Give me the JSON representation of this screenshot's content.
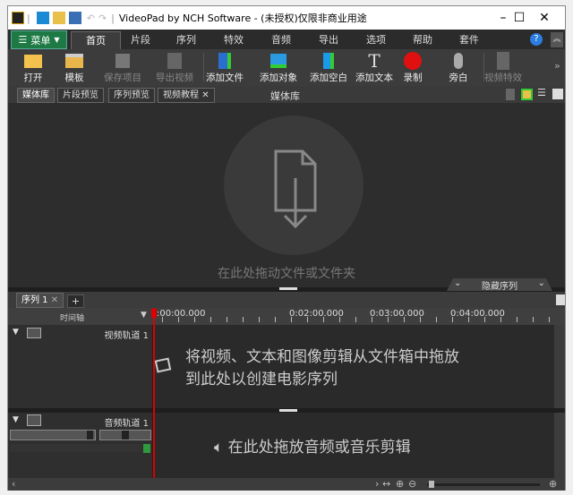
{
  "title": "VideoPad by NCH Software - (未授权)仅限非商业用途",
  "menu_label": "菜单",
  "tabs": [
    "首页",
    "片段",
    "序列",
    "特效",
    "音频",
    "导出",
    "选项",
    "帮助",
    "套件"
  ],
  "toolbar": [
    {
      "label": "打开",
      "icon": "folder-open-icon",
      "enabled": true
    },
    {
      "label": "模板",
      "icon": "template-folder-icon",
      "enabled": true
    },
    {
      "label": "保存项目",
      "icon": "save-icon",
      "enabled": false
    },
    {
      "label": "导出视频",
      "icon": "export-video-icon",
      "enabled": false
    },
    {
      "label": "添加文件",
      "icon": "add-file-icon",
      "enabled": true
    },
    {
      "label": "添加对象",
      "icon": "add-object-icon",
      "enabled": true
    },
    {
      "label": "添加空白",
      "icon": "add-blank-icon",
      "enabled": true
    },
    {
      "label": "添加文本",
      "icon": "add-text-icon",
      "enabled": true
    },
    {
      "label": "录制",
      "icon": "record-icon",
      "enabled": true
    },
    {
      "label": "旁白",
      "icon": "microphone-icon",
      "enabled": true
    },
    {
      "label": "视频特效",
      "icon": "video-effects-icon",
      "enabled": false
    }
  ],
  "panel_tabs": [
    "媒体库",
    "片段预览",
    "序列预览",
    "视频教程"
  ],
  "panel_title": "媒体库",
  "media_hint": "在此处拖动文件或文件夹",
  "hidden_sequence": "隐藏序列",
  "sequence_tab": "序列 1",
  "timeline_label": "时间轴",
  "ruler_labels": [
    ":00:00.000",
    "0:02:00.000",
    "0:03:00.000",
    "0:04:00.000"
  ],
  "video_track": {
    "name": "视频轨道 1",
    "hint_line1": "将视频、文本和图像剪辑从文件箱中拖放",
    "hint_line2": "到此处以创建电影序列"
  },
  "audio_track": {
    "name": "音频轨道 1",
    "hint": "在此处拖放音频或音乐剪辑"
  },
  "colors": {
    "accent_green": "#1e7a45",
    "playhead": "#dd0000",
    "record": "#e01010"
  }
}
